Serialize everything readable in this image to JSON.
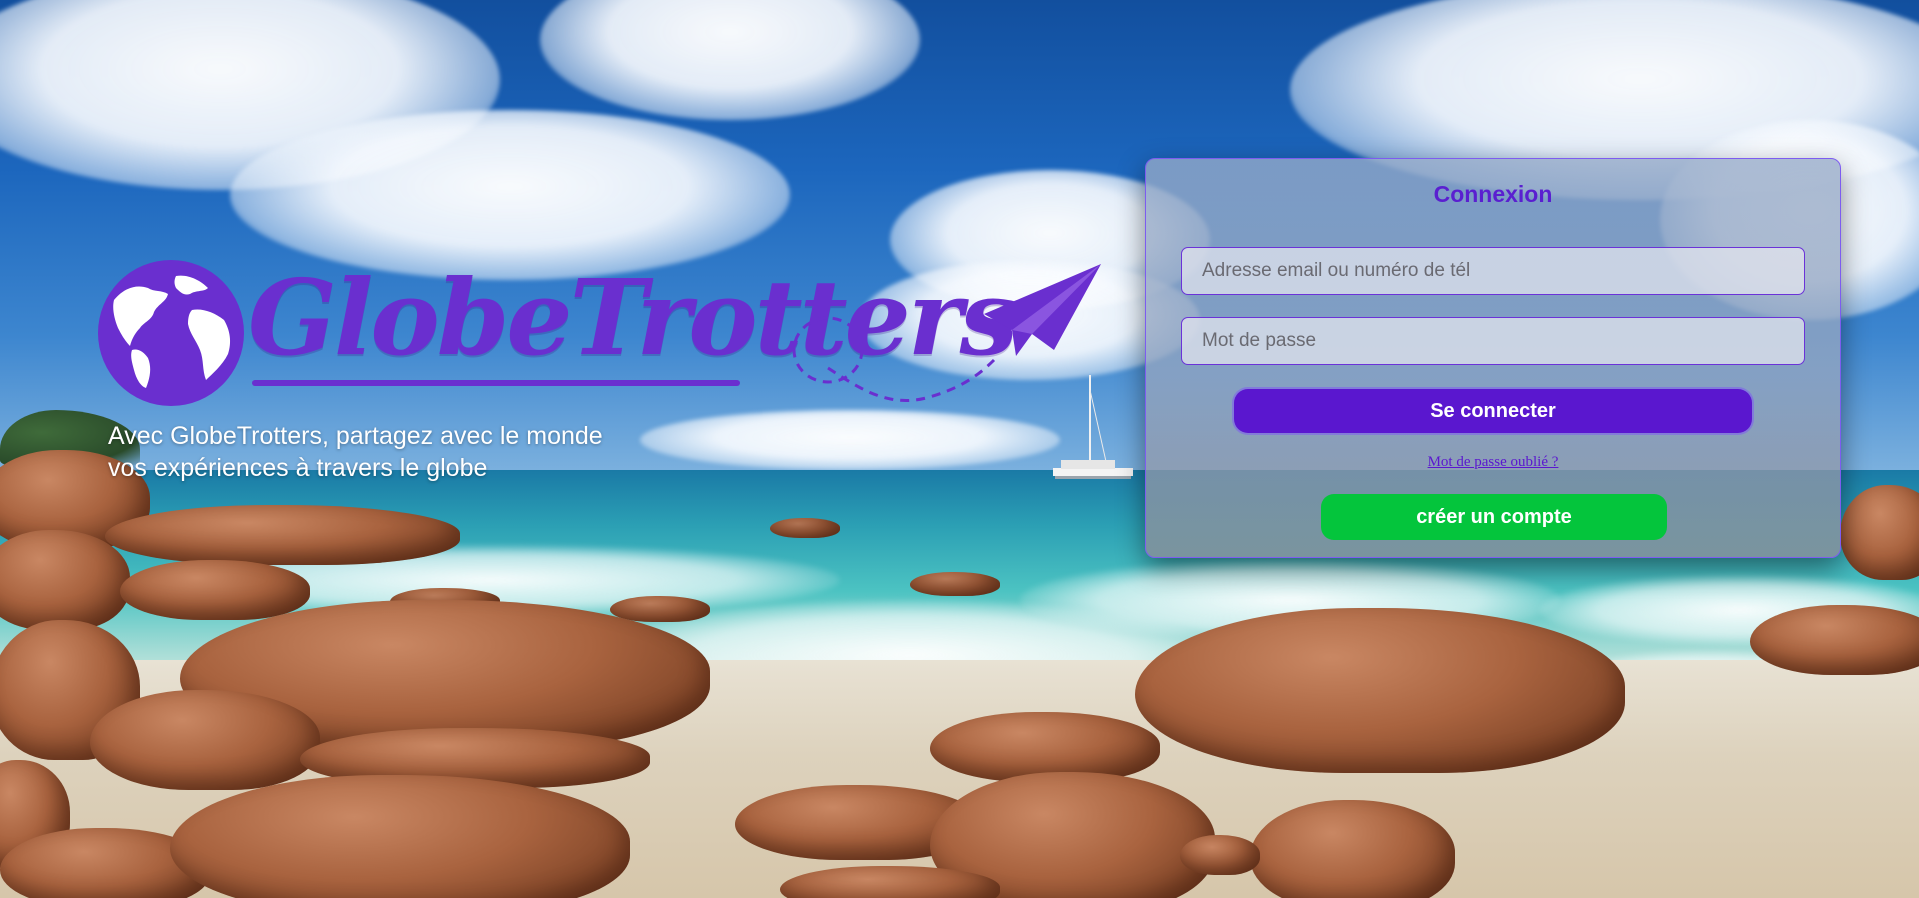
{
  "brand": {
    "name": "GlobeTrotters",
    "tagline_line1": "Avec GlobeTrotters, partagez avec le monde",
    "tagline_line2": "vos expériences à travers le globe",
    "logo_icon": "globe-icon",
    "decoration_icon": "paper-plane-icon",
    "brand_color": "#6a2fcf"
  },
  "login": {
    "title": "Connexion",
    "email_placeholder": "Adresse email ou numéro de tél",
    "password_placeholder": "Mot de passe",
    "login_button": "Se connecter",
    "forgot_password": "Mot de passe oublié ?",
    "create_account_button": "créer un compte"
  },
  "colors": {
    "accent": "#5a17cf",
    "create_button": "#04c53c",
    "panel_border": "#7d5cf0"
  },
  "background": {
    "scene": "beach-photo"
  }
}
